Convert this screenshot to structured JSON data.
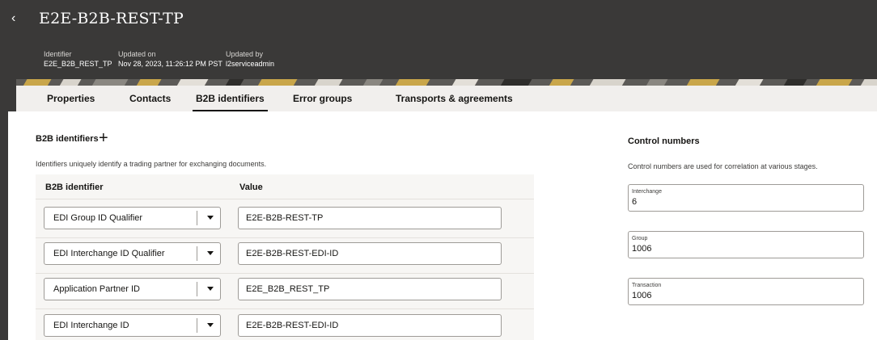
{
  "header": {
    "title": "E2E-B2B-REST-TP",
    "meta": [
      {
        "label": "Identifier",
        "value": "E2E_B2B_REST_TP"
      },
      {
        "label": "Updated on",
        "value": "Nov 28, 2023, 11:26:12 PM PST"
      },
      {
        "label": "Updated by",
        "value": "l2serviceadmin"
      }
    ]
  },
  "tabs": [
    {
      "label": "Properties"
    },
    {
      "label": "Contacts"
    },
    {
      "label": "B2B identifiers",
      "active": true
    },
    {
      "label": "Error groups"
    },
    {
      "label": "Transports & agreements"
    }
  ],
  "identifiers": {
    "title": "B2B identifiers",
    "description": "Identifiers uniquely identify a trading partner for exchanging documents.",
    "columns": [
      "B2B identifier",
      "Value"
    ],
    "rows": [
      {
        "type": "EDI Group ID Qualifier",
        "value": "E2E-B2B-REST-TP"
      },
      {
        "type": "EDI Interchange ID Qualifier",
        "value": "E2E-B2B-REST-EDI-ID"
      },
      {
        "type": "Application Partner ID",
        "value": "E2E_B2B_REST_TP"
      },
      {
        "type": "EDI Interchange ID",
        "value": "E2E-B2B-REST-EDI-ID"
      }
    ]
  },
  "control_numbers": {
    "title": "Control numbers",
    "description": "Control numbers are used for correlation at various stages.",
    "fields": [
      {
        "label": "Interchange",
        "value": "6"
      },
      {
        "label": "Group",
        "value": "1006"
      },
      {
        "label": "Transaction",
        "value": "1006"
      }
    ]
  },
  "colors": {
    "header_bg": "#3a3938",
    "tabs_bg": "#f1efed",
    "table_bg": "#f7f6f4"
  },
  "icons": {
    "back": "chevron-left-icon",
    "add": "plus-icon",
    "select": "caret-down-icon"
  }
}
